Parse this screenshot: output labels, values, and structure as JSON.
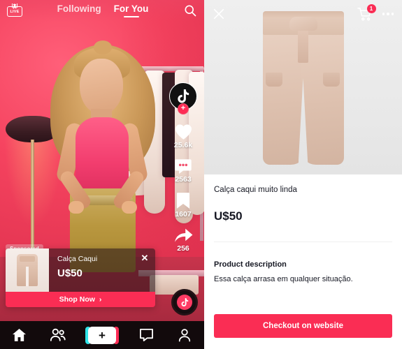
{
  "feed": {
    "live_label": "LIVE",
    "tabs": [
      {
        "label": "Following",
        "active": false
      },
      {
        "label": "For You",
        "active": true
      }
    ],
    "search_icon": "search-icon",
    "rail": {
      "avatar_icon": "tiktok-note-icon",
      "follow_label": "+",
      "like_icon": "heart-icon",
      "like_count": "25.6k",
      "comment_icon": "comment-icon",
      "comment_count": "2563",
      "bookmark_icon": "bookmark-icon",
      "bookmark_count": "1607",
      "share_icon": "share-arrow-icon",
      "share_count": "256",
      "music_disc_icon": "music-disc-icon"
    },
    "sponsored_label": "Sponsored",
    "product_card": {
      "name": "Calça Caqui",
      "price": "U$50",
      "cta": "Shop Now",
      "cta_chevron": "›",
      "close_icon": "close-icon",
      "thumb_icon": "product-thumbnail"
    },
    "tabbar": [
      {
        "name": "home",
        "icon": "home-icon",
        "label": ""
      },
      {
        "name": "friends",
        "icon": "friends-icon",
        "label": ""
      },
      {
        "name": "create",
        "icon": "plus-icon",
        "label": "+"
      },
      {
        "name": "inbox",
        "icon": "inbox-icon",
        "label": ""
      },
      {
        "name": "profile",
        "icon": "person-icon",
        "label": ""
      }
    ]
  },
  "pdp": {
    "close_icon": "close-icon",
    "cart_icon": "shopping-cart-icon",
    "cart_badge": "1",
    "more_icon": "more-options-icon",
    "hero_image": "khaki-paperbag-trousers",
    "title": "Calça caqui muito linda",
    "price": "U$50",
    "description_heading": "Product description",
    "description": "Essa calça arrasa em qualquer situação.",
    "checkout_label": "Checkout on website"
  },
  "colors": {
    "accent": "#fa2d54",
    "feed_bg": "#ef4e6c",
    "tabbar_bg": "#120a0c",
    "pdp_bg": "#ffffff",
    "hero_bg": "#ebebeb",
    "text_dark": "#161823"
  }
}
